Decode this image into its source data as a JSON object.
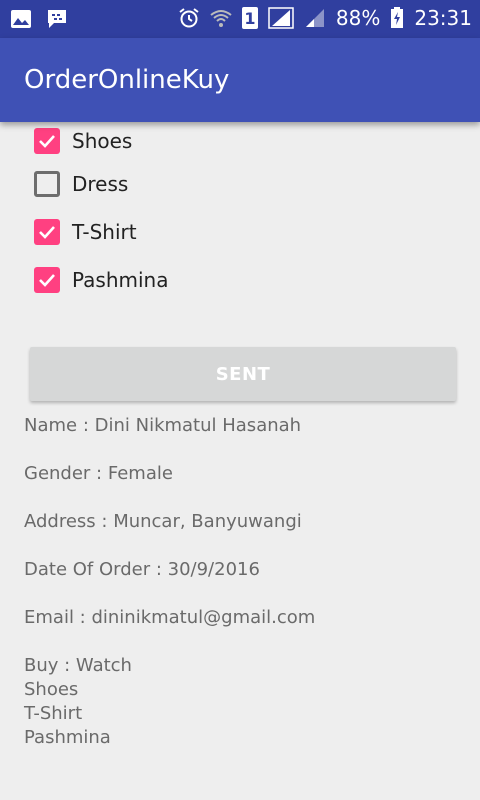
{
  "status_bar": {
    "battery": "88%",
    "time": "23:31",
    "sim": "1",
    "icons": [
      "image-icon",
      "bbm-icon",
      "alarm-icon",
      "wifi-icon",
      "sim-icon",
      "signal-icon",
      "signal-weak-icon",
      "battery-icon"
    ]
  },
  "app_bar": {
    "title": "OrderOnlineKuy"
  },
  "colors": {
    "primary": "#3f51b5",
    "primary_dark": "#303f9f",
    "accent": "#ff4081",
    "button": "#d6d7d7"
  },
  "checkboxes": [
    {
      "label": "Shoes",
      "checked": true
    },
    {
      "label": "Dress",
      "checked": false
    },
    {
      "label": "T-Shirt",
      "checked": true
    },
    {
      "label": "Pashmina",
      "checked": true
    }
  ],
  "button": {
    "label": "SENT"
  },
  "result": {
    "name": "Name : Dini Nikmatul Hasanah",
    "gender": "Gender : Female",
    "address": "Address : Muncar, Banyuwangi",
    "date": "Date Of Order : 30/9/2016",
    "email": "Email : dininikmatul@gmail.com",
    "buy_lines": [
      "Buy : Watch",
      "Shoes",
      "T-Shirt",
      "Pashmina"
    ]
  }
}
